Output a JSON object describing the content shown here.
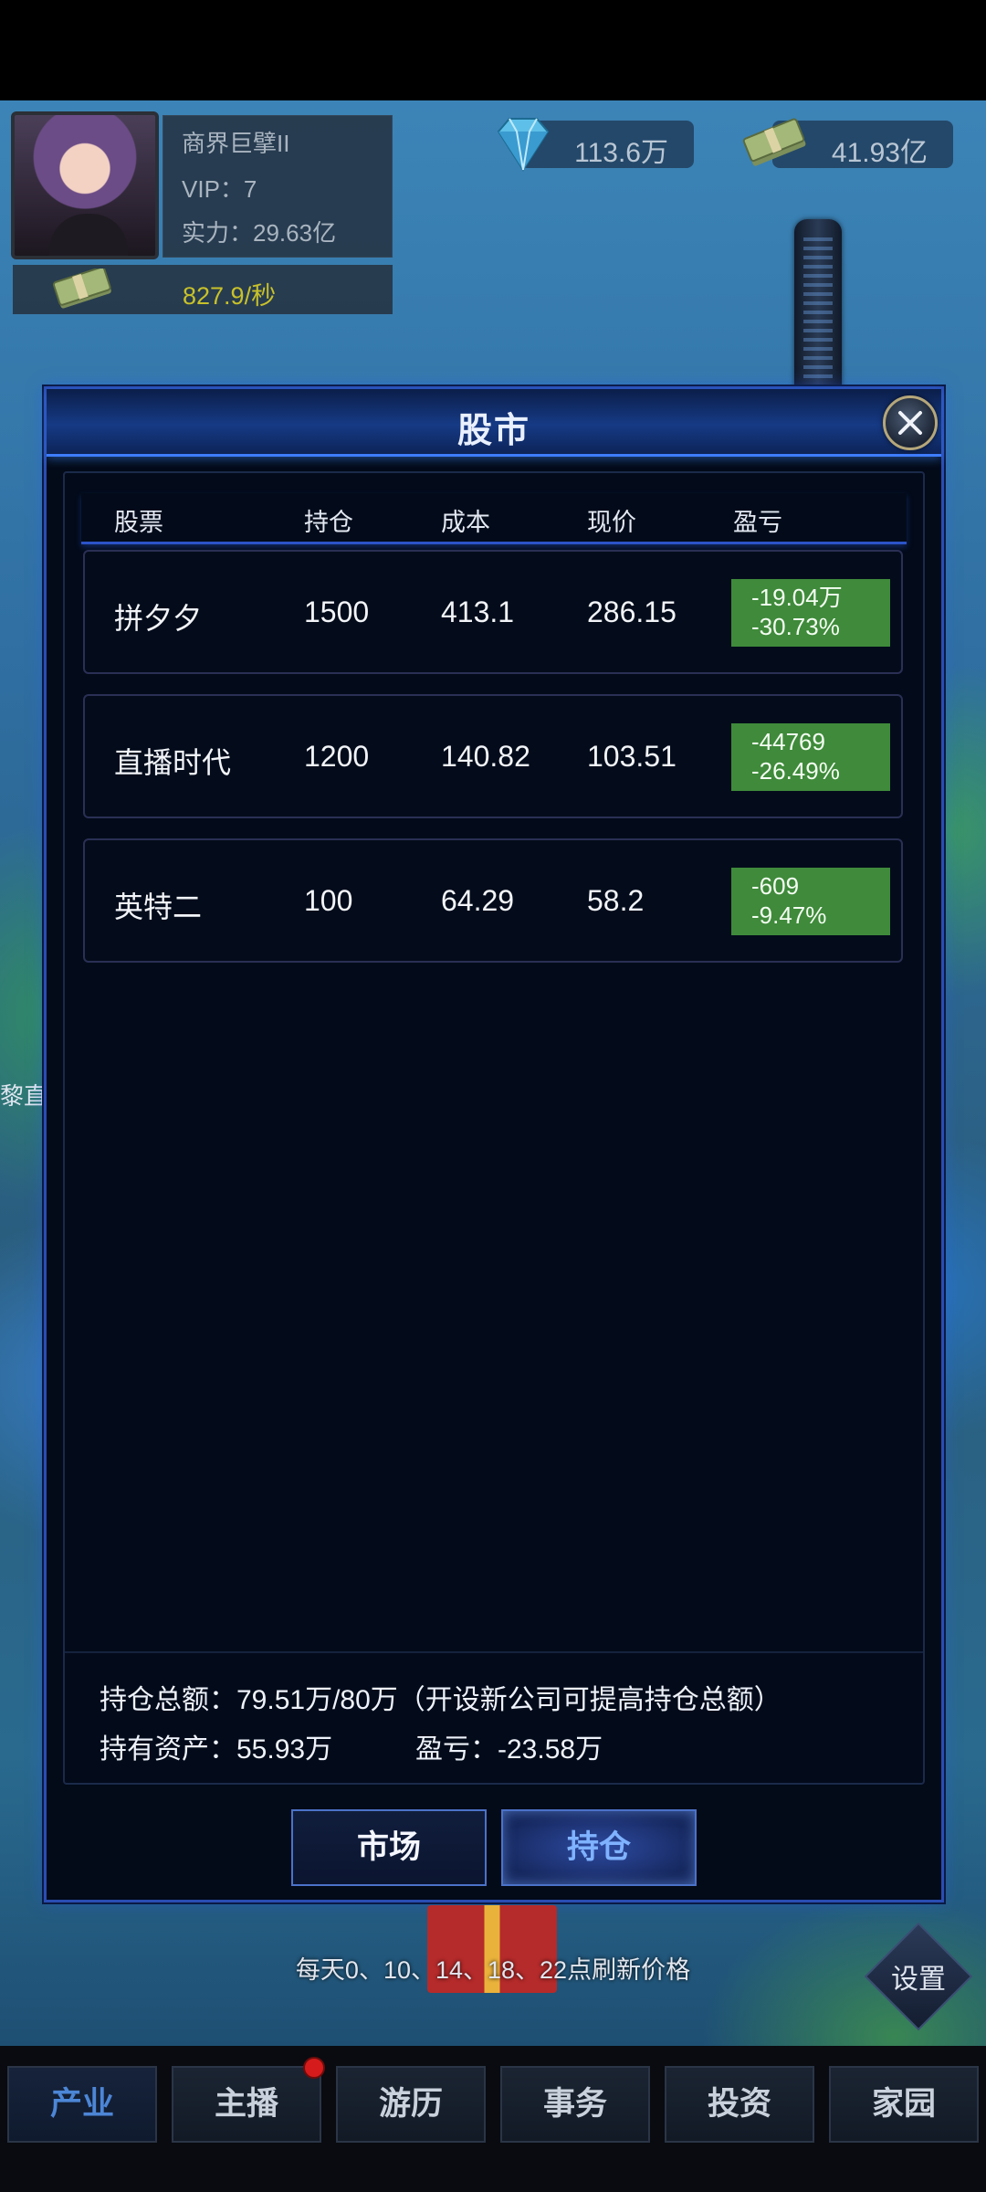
{
  "player": {
    "name": "商界巨擘II",
    "vip": "VIP：7",
    "power": "实力：29.63亿",
    "income": "827.9/秒"
  },
  "resources": {
    "diamonds": "113.6万",
    "cash": "41.93亿"
  },
  "dialog": {
    "title": "股市",
    "columns": [
      "股票",
      "持仓",
      "成本",
      "现价",
      "盈亏"
    ],
    "rows": [
      {
        "name": "拼夕夕",
        "holding": "1500",
        "cost": "413.1",
        "price": "286.15",
        "pl_amount": "-19.04万",
        "pl_percent": "-30.73%"
      },
      {
        "name": "直播时代",
        "holding": "1200",
        "cost": "140.82",
        "price": "103.51",
        "pl_amount": "-44769",
        "pl_percent": "-26.49%"
      },
      {
        "name": "英特二",
        "holding": "100",
        "cost": "64.29",
        "price": "58.2",
        "pl_amount": "-609",
        "pl_percent": "-9.47%"
      }
    ],
    "summary": {
      "total_holdings": "持仓总额：79.51万/80万（开设新公司可提高持仓总额）",
      "assets": "持有资产：55.93万",
      "profit_loss": "盈亏：-23.58万"
    },
    "tabs": {
      "market": "市场",
      "holdings": "持仓"
    }
  },
  "refresh_note": "每天0、10、14、18、22点刷新价格",
  "settings_label": "设置",
  "side_label": "黎直",
  "bottom_nav": [
    "产业",
    "主播",
    "游历",
    "事务",
    "投资",
    "家园"
  ],
  "colors": {
    "loss_badge": "#3f8a3b",
    "dialog_border": "#2a4db3",
    "active_tab_text": "#7fb2ff",
    "income_text": "#c8c12a"
  },
  "icons": [
    "diamond-icon",
    "cash-icon",
    "close-icon",
    "settings-icon",
    "gift-icon"
  ]
}
